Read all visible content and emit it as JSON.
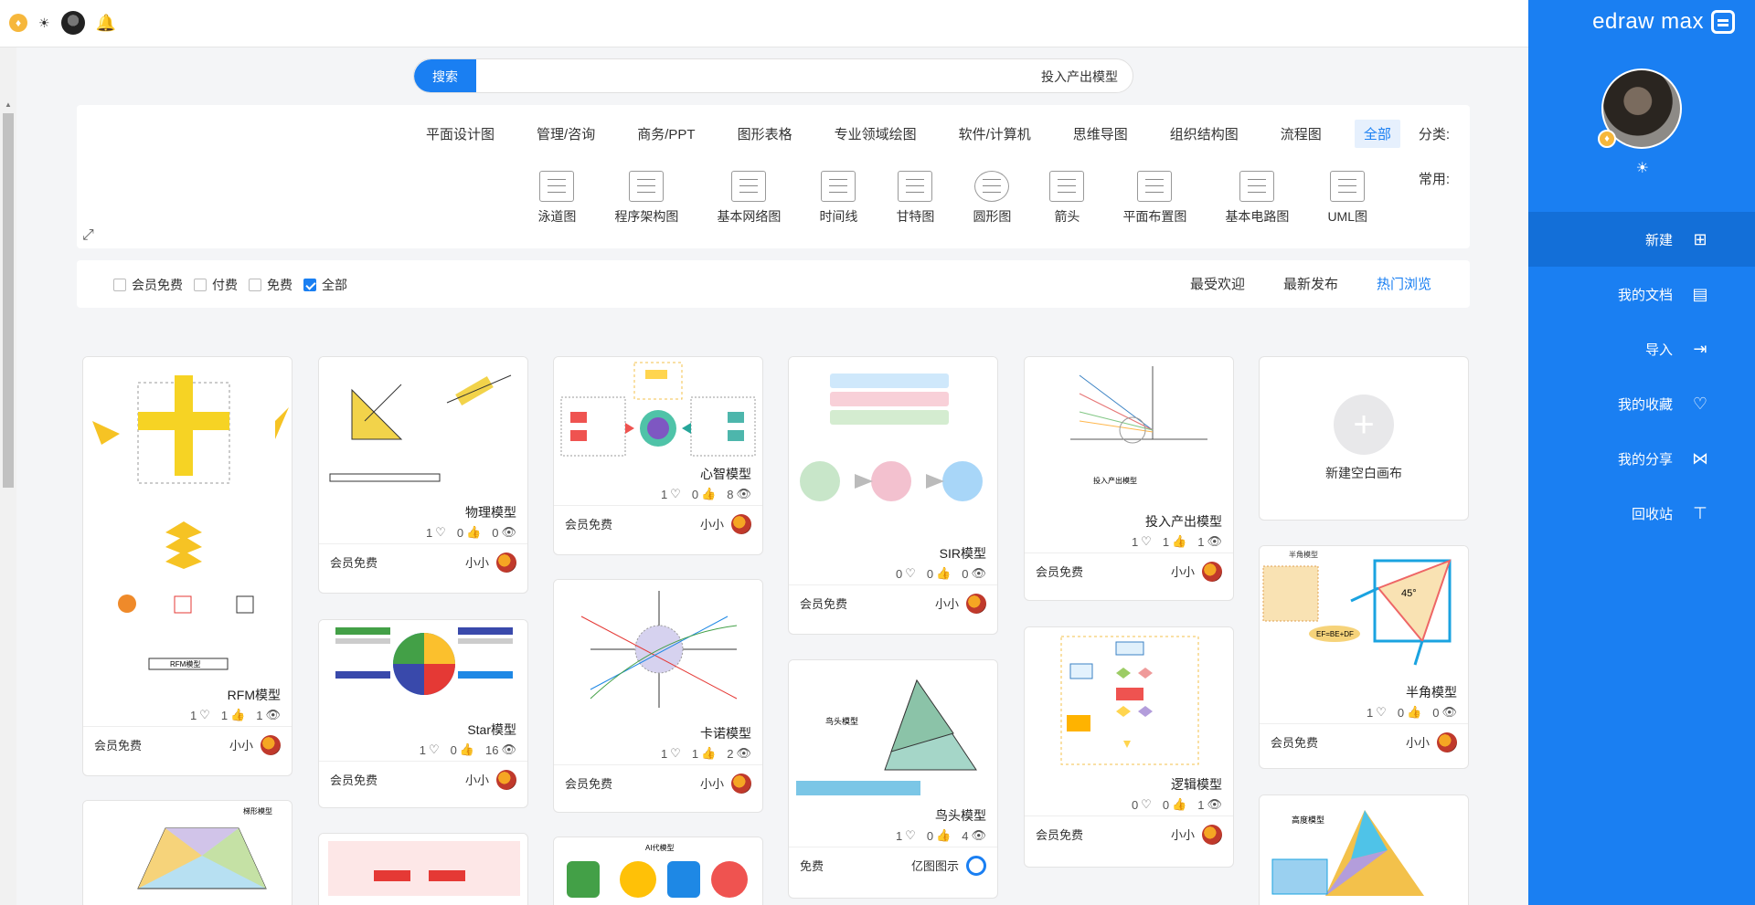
{
  "brand": {
    "name": "edraw max"
  },
  "nav": [
    {
      "label": "新建",
      "icon": "new-file-icon"
    },
    {
      "label": "我的文档",
      "icon": "document-icon"
    },
    {
      "label": "导入",
      "icon": "import-icon"
    },
    {
      "label": "我的收藏",
      "icon": "heart-icon"
    },
    {
      "label": "我的分享",
      "icon": "share-icon"
    },
    {
      "label": "回收站",
      "icon": "trash-icon"
    }
  ],
  "search": {
    "button": "搜索",
    "value": "投入产出模型"
  },
  "categories": {
    "label": "分类:",
    "items": [
      "全部",
      "流程图",
      "组织结构图",
      "思维导图",
      "软件/计算机",
      "专业领域绘图",
      "图形表格",
      "商务/PPT",
      "管理/咨询",
      "平面设计图"
    ]
  },
  "common": {
    "label": "常用:",
    "items": [
      "UML图",
      "基本电路图",
      "平面布置图",
      "箭头",
      "圆形图",
      "甘特图",
      "时间线",
      "基本网络图",
      "程序架构图",
      "泳道图"
    ]
  },
  "sort_tabs": [
    "热门浏览",
    "最新发布",
    "最受欢迎"
  ],
  "filters": [
    {
      "label": "全部",
      "checked": true
    },
    {
      "label": "免费",
      "checked": false
    },
    {
      "label": "付费",
      "checked": false
    },
    {
      "label": "会员免费",
      "checked": false
    }
  ],
  "new_canvas": "新建空白画布",
  "cards": [
    {
      "title": "半角模型",
      "views": "0",
      "likes": "0",
      "favs": "1",
      "author": "小小",
      "price": "会员免费"
    },
    {
      "title": "高度模型",
      "views": "",
      "likes": "",
      "favs": "",
      "author": "",
      "price": ""
    },
    {
      "title": "投入产出模型",
      "views": "1",
      "likes": "1",
      "favs": "1",
      "author": "小小",
      "price": "会员免费"
    },
    {
      "title": "逻辑模型",
      "views": "1",
      "likes": "0",
      "favs": "0",
      "author": "小小",
      "price": "会员免费"
    },
    {
      "title": "SIR模型",
      "views": "0",
      "likes": "0",
      "favs": "0",
      "author": "小小",
      "price": "会员免费"
    },
    {
      "title": "鸟头模型",
      "views": "4",
      "likes": "0",
      "favs": "1",
      "author": "亿图图示",
      "price": "免费"
    },
    {
      "title": "心智模型",
      "views": "8",
      "likes": "0",
      "favs": "1",
      "author": "小小",
      "price": "会员免费"
    },
    {
      "title": "卡诺模型",
      "views": "2",
      "likes": "1",
      "favs": "1",
      "author": "小小",
      "price": "会员免费"
    },
    {
      "title": "物理模型",
      "views": "0",
      "likes": "0",
      "favs": "1",
      "author": "小小",
      "price": "会员免费"
    },
    {
      "title": "Star模型",
      "views": "16",
      "likes": "0",
      "favs": "1",
      "author": "小小",
      "price": "会员免费"
    },
    {
      "title": "RFM模型",
      "views": "1",
      "likes": "1",
      "favs": "1",
      "author": "小小",
      "price": "会员免费"
    }
  ],
  "thumb_text": {
    "half_angle": "半角模型",
    "half_angle_eq": "EF=BE+DF",
    "angle": "45°",
    "height_model": "高度模型",
    "io_model": "投入产出模型",
    "bird_head": "鸟头模型",
    "trap": "梯形模型",
    "ai": "AI代模型",
    "rfm": "RFM模型"
  },
  "colors": {
    "primary": "#1a7ff2",
    "sidebar_active": "#136fd8",
    "vip": "#f6b73c"
  }
}
